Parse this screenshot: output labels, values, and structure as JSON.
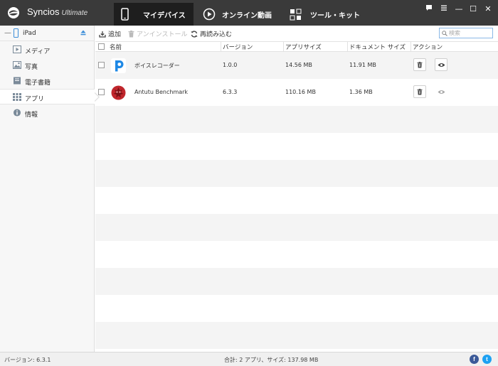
{
  "app": {
    "name": "Syncios",
    "edition": "Ultimate"
  },
  "main_tabs": [
    {
      "label": "マイデバイス",
      "active": true
    },
    {
      "label": "オンライン動画",
      "active": false
    },
    {
      "label": "ツール・キット",
      "active": false
    }
  ],
  "window_controls": {
    "feedback_icon": "chat-icon",
    "menu_icon": "menu-icon",
    "minimize": "—",
    "maximize": "☐",
    "close": "✕"
  },
  "device": {
    "name": "iPad",
    "collapse_symbol": "—"
  },
  "sidebar": {
    "items": [
      {
        "label": "メディア",
        "icon": "media-icon",
        "active": false
      },
      {
        "label": "写真",
        "icon": "photo-icon",
        "active": false
      },
      {
        "label": "電子書籍",
        "icon": "book-icon",
        "active": false
      },
      {
        "label": "アプリ",
        "icon": "apps-grid-icon",
        "active": true
      },
      {
        "label": "情報",
        "icon": "info-icon",
        "active": false
      }
    ]
  },
  "toolbar": {
    "add_label": "追加",
    "uninstall_label": "アンインストール",
    "reload_label": "再読み込む",
    "search_placeholder": "検索"
  },
  "table": {
    "headers": {
      "name": "名前",
      "version": "バージョン",
      "app_size": "アプリサイズ",
      "doc_size": "ドキュメント サイズ",
      "action": "アクション"
    },
    "rows": [
      {
        "name": "ボイスレコーダー",
        "version": "1.0.0",
        "app_size": "14.56 MB",
        "doc_size": "11.91 MB",
        "icon": "voice-recorder-app-icon"
      },
      {
        "name": "Antutu Benchmark",
        "version": "6.3.3",
        "app_size": "110.16 MB",
        "doc_size": "1.36 MB",
        "icon": "antutu-app-icon"
      }
    ]
  },
  "status": {
    "version": "バージョン: 6.3.1",
    "summary": "合計: 2 アプリ、サイズ: 137.98 MB"
  },
  "social": {
    "facebook": "f",
    "twitter": "t"
  },
  "colors": {
    "titlebar": "#3a3a3a",
    "active_tab": "#1e1e1e",
    "accent_blue": "#3c8ed8",
    "antutu_red": "#c0262c",
    "facebook": "#3b5998",
    "twitter": "#1da1f2"
  }
}
